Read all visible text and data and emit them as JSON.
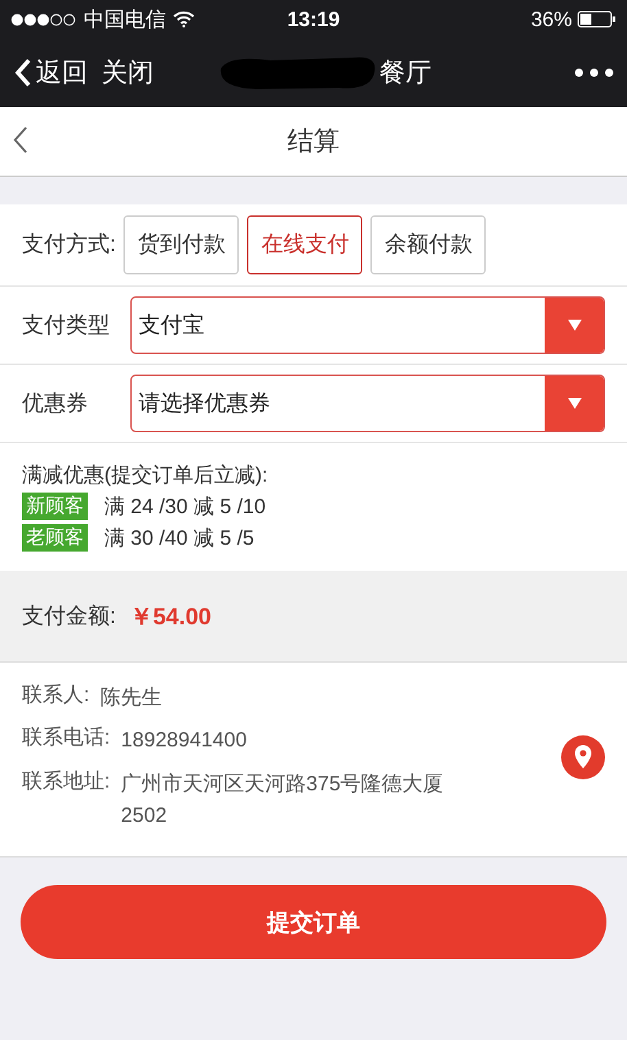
{
  "status_bar": {
    "carrier": "中国电信",
    "time": "13:19",
    "battery": "36%"
  },
  "nav_bar": {
    "back": "返回",
    "close": "关闭",
    "title": "餐厅"
  },
  "header": {
    "title": "结算"
  },
  "payment_method": {
    "label": "支付方式:",
    "options": [
      {
        "label": "货到付款",
        "selected": false
      },
      {
        "label": "在线支付",
        "selected": true
      },
      {
        "label": "余额付款",
        "selected": false
      }
    ]
  },
  "selects": [
    {
      "label": "支付类型",
      "value": "支付宝"
    },
    {
      "label": "优惠券",
      "value": "请选择优惠券"
    }
  ],
  "promotions": {
    "title": "满减优惠(提交订单后立减):",
    "items": [
      {
        "tag": "新顾客",
        "text": "满 24 /30 减 5 /10"
      },
      {
        "tag": "老顾客",
        "text": "满 30 /40 减 5 /5"
      }
    ]
  },
  "amount": {
    "label": "支付金额:",
    "value": "￥54.00"
  },
  "contact": {
    "lines": [
      {
        "label": "联系人:",
        "value": "陈先生"
      },
      {
        "label": "联系电话:",
        "value": "18928941400"
      },
      {
        "label": "联系地址:",
        "value": "广州市天河区天河路375号隆德大厦2502"
      }
    ]
  },
  "submit": "提交订单"
}
